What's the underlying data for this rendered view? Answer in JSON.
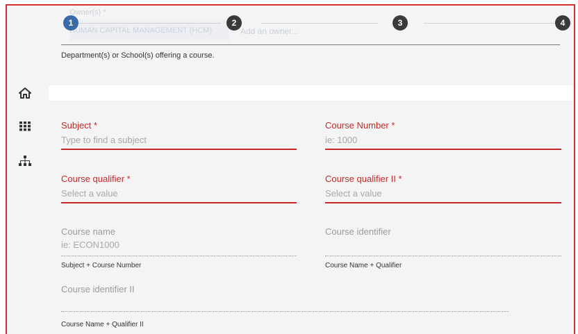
{
  "stepper": {
    "steps": [
      "1",
      "2",
      "3",
      "4"
    ],
    "active": 0
  },
  "owner": {
    "ghost_label": "Owner(s) *",
    "ghost_value": "HUMAN CAPITAL MANAGEMENT (HCM)",
    "ghost_placeholder": "Add an owner...",
    "helper": "Department(s) or School(s) offering a course."
  },
  "form": {
    "subject": {
      "label": "Subject *",
      "placeholder": "Type to find a subject"
    },
    "course_number": {
      "label": "Course Number *",
      "placeholder": "ie: 1000"
    },
    "course_qualifier": {
      "label": "Course qualifier *",
      "placeholder": "Select a value"
    },
    "course_qualifier_ii": {
      "label": "Course qualifier II *",
      "placeholder": "Select a value"
    },
    "course_name": {
      "label": "Course name",
      "placeholder": "ie: ECON1000",
      "helper": "Subject + Course Number"
    },
    "course_identifier": {
      "label": "Course identifier",
      "helper": "Course Name + Qualifier"
    },
    "course_identifier_ii": {
      "label": "Course identifier II",
      "helper": "Course Name + Qualifier II"
    }
  },
  "colors": {
    "accent_red": "#c62828",
    "step_active": "#3b6aa8",
    "step_idle": "#3a3a3a"
  },
  "icons": [
    "home-icon",
    "grid-icon",
    "sitemap-icon"
  ]
}
